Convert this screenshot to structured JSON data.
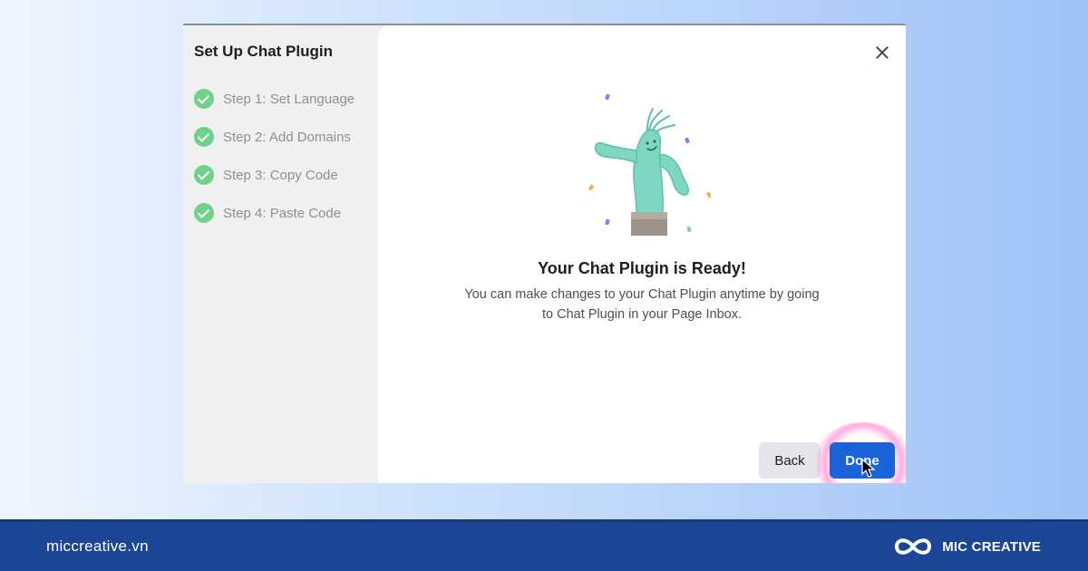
{
  "sidebar": {
    "title": "Set Up Chat Plugin",
    "steps": [
      {
        "label": "Step 1: Set Language",
        "status": "complete"
      },
      {
        "label": "Step 2: Add Domains",
        "status": "complete"
      },
      {
        "label": "Step 3: Copy Code",
        "status": "complete"
      },
      {
        "label": "Step 4: Paste Code",
        "status": "complete"
      }
    ]
  },
  "main": {
    "heading": "Your Chat Plugin is Ready!",
    "description": "You can make changes to your Chat Plugin anytime by going to Chat Plugin in your Page Inbox.",
    "close_icon": "close-icon",
    "illustration_icon": "inflatable-tube-man-icon"
  },
  "actions": {
    "back_label": "Back",
    "done_label": "Done"
  },
  "footer": {
    "website": "miccreative.vn",
    "brand_name": "MIC CREATIVE",
    "brand_logo_icon": "infinity-logo-icon"
  },
  "colors": {
    "primary_button": "#1a63d8",
    "check_green": "#6fd18a",
    "footer_bg": "#1c4595"
  }
}
